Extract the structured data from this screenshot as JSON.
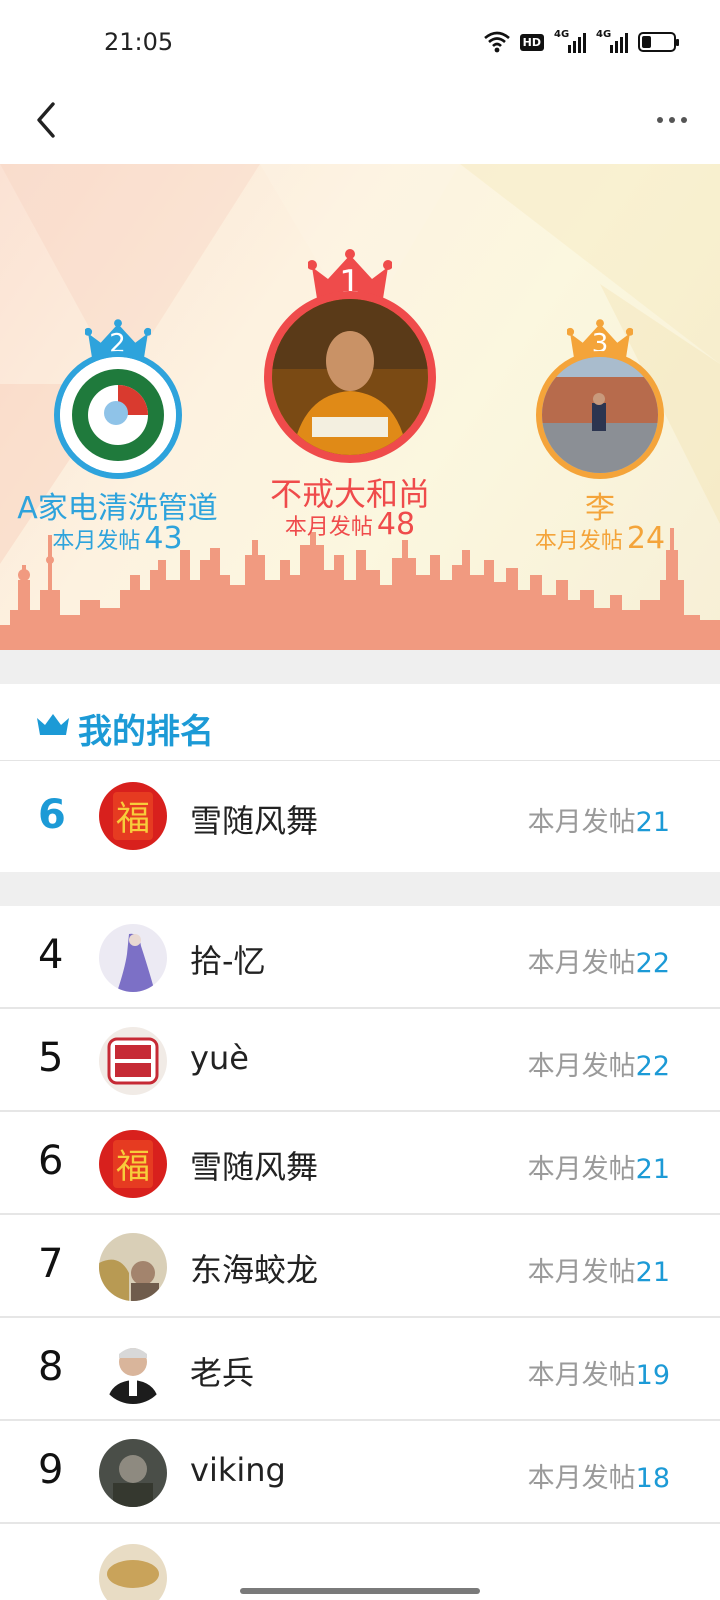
{
  "status_bar": {
    "time": "21:05",
    "icons": [
      "wifi-icon",
      "hd-icon",
      "signal-4g-icon",
      "signal-4g-icon",
      "battery-icon"
    ],
    "hd_label": "HD",
    "net_label": "4G",
    "battery_level": 0.3
  },
  "nav": {
    "back_icon": "chevron-left-icon",
    "more_icon": "more-horizontal-icon"
  },
  "podium": {
    "posts_label": "本月发帖",
    "first": {
      "rank": "1",
      "name": "不戒大和尚",
      "posts": "48",
      "color": "#ef4b4b"
    },
    "second": {
      "rank": "2",
      "name": "A家电清洗管道",
      "posts": "43",
      "color": "#2ea3dc"
    },
    "third": {
      "rank": "3",
      "name": "李",
      "posts": "24",
      "color": "#f4a43a"
    }
  },
  "my_rank": {
    "title": "我的排名",
    "icon": "crown-icon",
    "rank": "6",
    "name": "雪随风舞",
    "posts_label": "本月发帖",
    "posts": "21"
  },
  "ranking": {
    "posts_label": "本月发帖",
    "rows": [
      {
        "rank": "4",
        "name": "拾-忆",
        "posts": "22"
      },
      {
        "rank": "5",
        "name": "yuè",
        "posts": "22"
      },
      {
        "rank": "6",
        "name": "雪随风舞",
        "posts": "21"
      },
      {
        "rank": "7",
        "name": "东海蛟龙",
        "posts": "21"
      },
      {
        "rank": "8",
        "name": "老兵",
        "posts": "19"
      },
      {
        "rank": "9",
        "name": "viking",
        "posts": "18"
      }
    ]
  },
  "colors": {
    "accent": "#1c9ad6",
    "gold": "#f4a43a",
    "red": "#ef4b4b",
    "skyline": "#f19a80"
  }
}
